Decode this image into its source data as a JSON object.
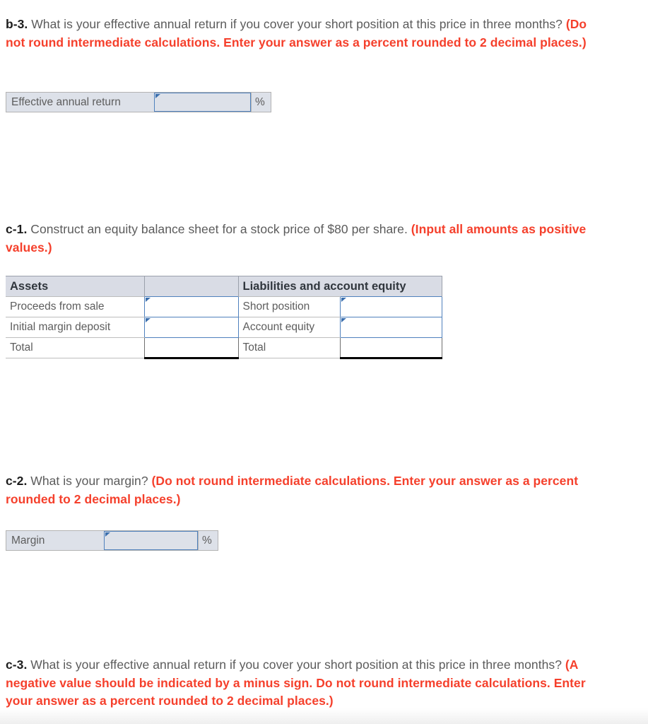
{
  "questions": [
    {
      "id": "b-3",
      "label": "b-3.",
      "text": " What is your effective annual return if you cover your short position at this price in three months? ",
      "note": "(Do not round intermediate calculations. Enter your answer as a percent rounded to 2 decimal places.)"
    },
    {
      "id": "c-1",
      "label": "c-1.",
      "text": " Construct an equity balance sheet for a stock price of $80 per share. ",
      "note": "(Input all amounts as positive values.)"
    },
    {
      "id": "c-2",
      "label": "c-2.",
      "text": " What is your margin? ",
      "note": "(Do not round intermediate calculations. Enter your answer as a percent rounded to 2 decimal places.)"
    },
    {
      "id": "c-3",
      "label": "c-3.",
      "text": " What is your effective annual return if you cover your short position at this price in three months? ",
      "note": "(A negative value should be indicated by a minus sign. Do not round intermediate calculations. Enter your answer as a percent rounded to 2 decimal places.)"
    }
  ],
  "answers": {
    "effective_annual_return": {
      "label": "Effective annual return",
      "value": "",
      "unit": "%"
    },
    "margin": {
      "label": "Margin",
      "value": "",
      "unit": "%"
    }
  },
  "balance_sheet": {
    "headers": {
      "assets": "Assets",
      "assets_amount": "",
      "liabilities": "Liabilities and account equity",
      "liabilities_amount": ""
    },
    "rows": [
      {
        "asset_label": "Proceeds from sale",
        "asset_value": "",
        "liability_label": "Short position",
        "liability_value": ""
      },
      {
        "asset_label": "Initial margin deposit",
        "asset_value": "",
        "liability_label": "Account equity",
        "liability_value": ""
      }
    ],
    "total_row": {
      "asset_label": "Total",
      "asset_value": "",
      "liability_label": "Total",
      "liability_value": ""
    }
  },
  "colors": {
    "note_red": "#f5402c",
    "field_blue_border": "#4f81bd",
    "field_fill": "#dde1e9",
    "header_fill": "#d9dce5",
    "marker_blue": "#3b6fae"
  }
}
